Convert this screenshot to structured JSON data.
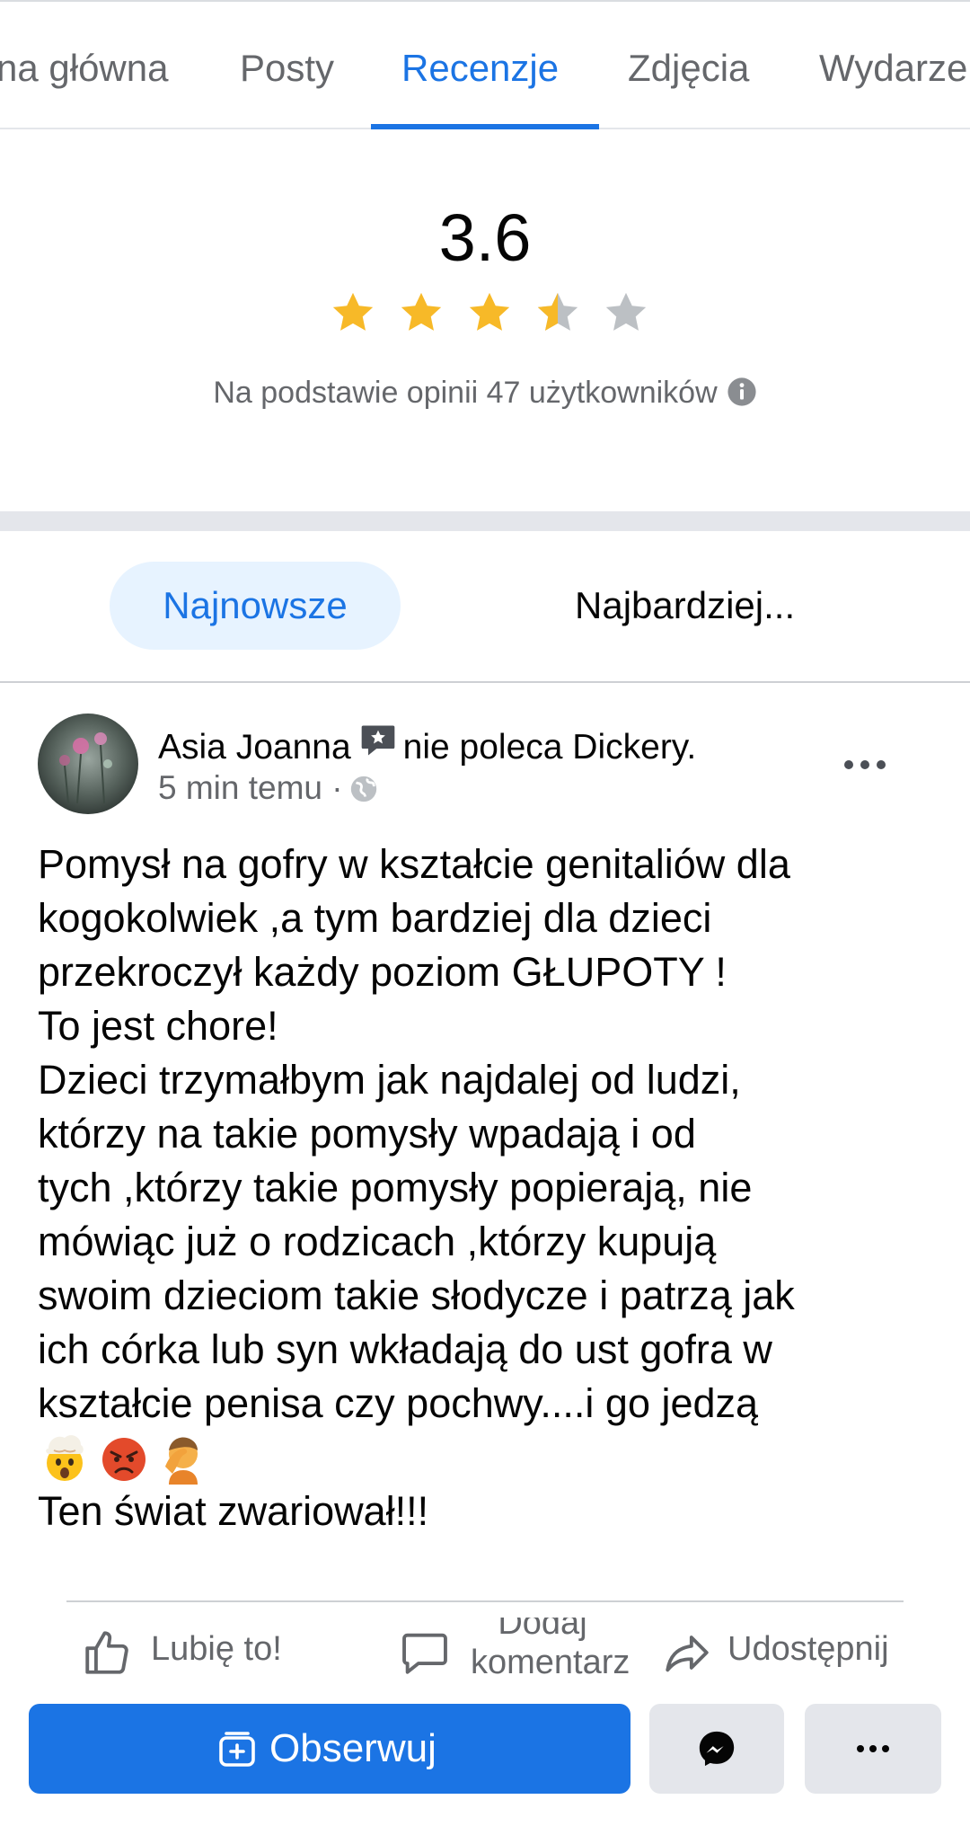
{
  "tabs": [
    {
      "label": "Strona główna",
      "visible_text": "na główna"
    },
    {
      "label": "Posty"
    },
    {
      "label": "Recenzje",
      "active": true
    },
    {
      "label": "Zdjęcia"
    },
    {
      "label": "Wydarzenia",
      "visible_text": "Wydarze"
    }
  ],
  "rating": {
    "score": "3.6",
    "stars_filled": 3.5,
    "stars_total": 5,
    "basis_text": "Na podstawie opinii 47 użytkowników"
  },
  "sort": {
    "active": "Najnowsze",
    "other": "Najbardziej..."
  },
  "review": {
    "author": "Asia Joanna",
    "verdict": "nie poleca Dickery.",
    "time": "5 min temu",
    "separator": "·",
    "paragraphs_before_emoji": [
      "Pomysł na gofry w kształcie genitaliów dla",
      "kogokolwiek ,a tym bardziej dla dzieci",
      "przekroczył każdy poziom GŁUPOTY !",
      "To jest chore!",
      "Dzieci trzymałbym jak najdalej od ludzi,",
      "którzy na takie pomysły wpadają i od",
      "tych ,którzy takie pomysły popierają, nie",
      "mówiąc już o rodzicach ,którzy kupują",
      "swoim dzieciom takie słodycze i patrzą jak",
      "ich córka lub syn wkładają do ust gofra w",
      "kształcie penisa czy pochwy....i go jedzą"
    ],
    "emojis": [
      "exploding-head-emoji",
      "angry-face-emoji",
      "facepalm-emoji"
    ],
    "last_line": "Ten świat zwariował!!!"
  },
  "actions": {
    "like": "Lubię to!",
    "comment_line1": "Dodaj",
    "comment_line2": "komentarz",
    "share": "Udostępnij"
  },
  "bottom": {
    "follow": "Obserwuj"
  },
  "colors": {
    "accent": "#1b74e4",
    "star": "#f7b928",
    "star_empty": "#bcc0c4",
    "secondary_text": "#65676b",
    "pill_bg": "#e7f3ff"
  }
}
